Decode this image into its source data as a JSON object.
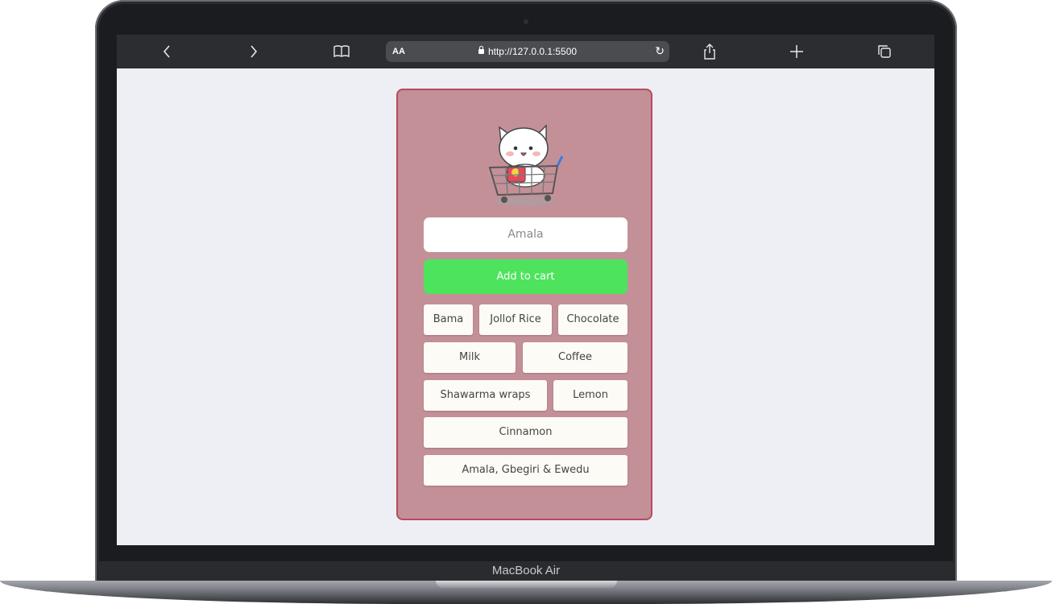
{
  "device": {
    "brand_label": "MacBook Air"
  },
  "browser": {
    "text_size_label": "AA",
    "url": "http://127.0.0.1:5500",
    "reload_icon": "reload-icon"
  },
  "app": {
    "input_value": "Amala",
    "add_button_label": "Add to cart",
    "accent_color": "#4ee35d",
    "card_color": "#c39098",
    "items": [
      "Bama",
      "Jollof Rice",
      "Chocolate",
      "Milk",
      "Coffee",
      "Shawarma wraps",
      "Lemon",
      "Cinnamon",
      "Amala, Gbegiri & Ewedu"
    ]
  }
}
